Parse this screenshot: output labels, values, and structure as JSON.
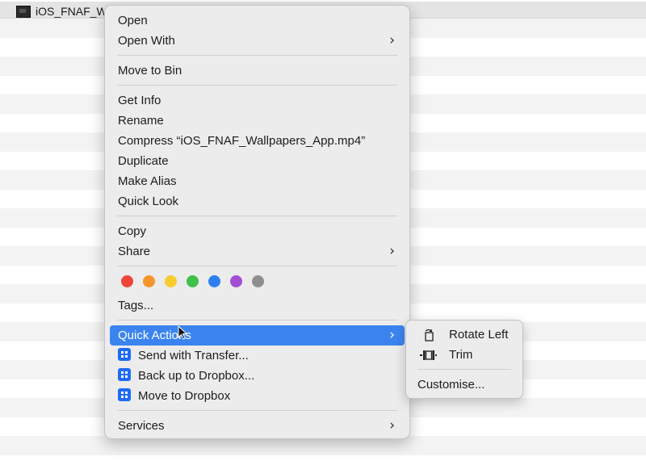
{
  "file": {
    "name": "iOS_FNAF_Wa",
    "icon": "video-file-icon"
  },
  "context_menu": {
    "items": {
      "open": "Open",
      "open_with": "Open With",
      "move_to_bin": "Move to Bin",
      "get_info": "Get Info",
      "rename": "Rename",
      "compress": "Compress “iOS_FNAF_Wallpapers_App.mp4”",
      "duplicate": "Duplicate",
      "make_alias": "Make Alias",
      "quick_look": "Quick Look",
      "copy": "Copy",
      "share": "Share",
      "tags": "Tags...",
      "quick_actions": "Quick Actions",
      "send_with_transfer": "Send with Transfer...",
      "back_up_to_dropbox": "Back up to Dropbox...",
      "move_to_dropbox": "Move to Dropbox",
      "services": "Services"
    },
    "tag_colors": [
      {
        "name": "red",
        "color": "#f0443a"
      },
      {
        "name": "orange",
        "color": "#f5962c"
      },
      {
        "name": "yellow",
        "color": "#f7cc2e"
      },
      {
        "name": "green",
        "color": "#3ec04a"
      },
      {
        "name": "blue",
        "color": "#2f7ff0"
      },
      {
        "name": "purple",
        "color": "#a24fd6"
      },
      {
        "name": "grey",
        "color": "#8e8e8e"
      }
    ],
    "highlight_color": "#3b84f0"
  },
  "quick_actions_submenu": {
    "rotate_left": "Rotate Left",
    "trim": "Trim",
    "customise": "Customise..."
  }
}
